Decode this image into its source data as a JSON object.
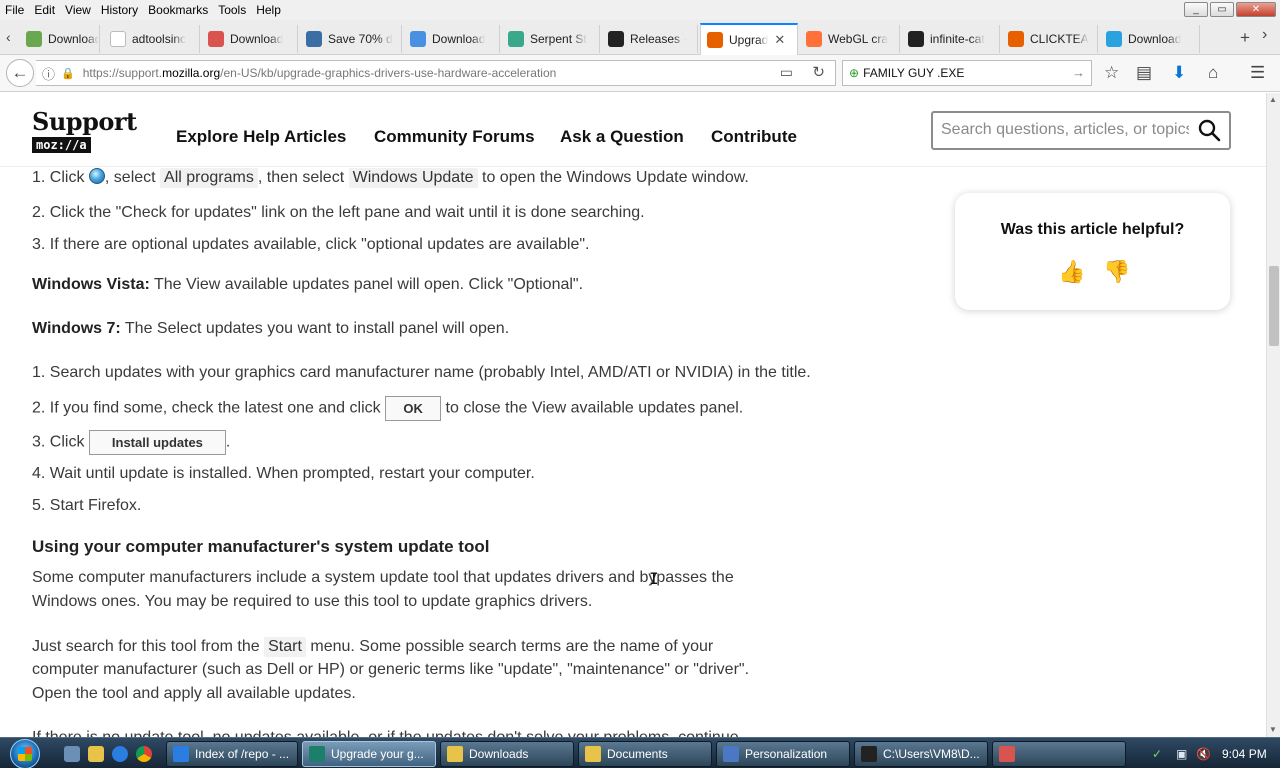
{
  "menubar": {
    "items": [
      {
        "label": "File",
        "key": "F"
      },
      {
        "label": "Edit",
        "key": "E"
      },
      {
        "label": "View",
        "key": "V"
      },
      {
        "label": "History",
        "key": "s"
      },
      {
        "label": "Bookmarks",
        "key": "B"
      },
      {
        "label": "Tools",
        "key": "T"
      },
      {
        "label": "Help",
        "key": "H"
      }
    ],
    "window_controls": [
      "_",
      "▭",
      "✕"
    ]
  },
  "tabs": [
    {
      "label": "Download",
      "color": "#6aa84f"
    },
    {
      "label": "adtoolsinc",
      "color": "#ffffff"
    },
    {
      "label": "Download",
      "color": "#d9534f"
    },
    {
      "label": "Save 70% d",
      "color": "#3b6ea5"
    },
    {
      "label": "Download",
      "color": "#4a90e2"
    },
    {
      "label": "Serpent St",
      "color": "#3aa98b"
    },
    {
      "label": "Releases ·",
      "color": "#222222"
    },
    {
      "label": "Upgrad",
      "color": "#e66000",
      "active": true
    },
    {
      "label": "WebGL cra",
      "color": "#ff7139"
    },
    {
      "label": "infinite-cat",
      "color": "#222222"
    },
    {
      "label": "CLICKTEA",
      "color": "#e66000"
    },
    {
      "label": "Download",
      "color": "#29a3e0"
    }
  ],
  "navbar": {
    "url_prefix": "https://support.",
    "url_domain": "mozilla.org",
    "url_path": "/en-US/kb/upgrade-graphics-drivers-use-hardware-acceleration",
    "search_value": "FAMILY GUY .EXE"
  },
  "site": {
    "logo_word": "Support",
    "logo_badge": "moz://a",
    "nav": [
      "Explore Help Articles",
      "Community Forums",
      "Ask a Question",
      "Contribute"
    ],
    "search_placeholder": "Search questions, articles, or topics"
  },
  "article": {
    "step1_num": "1. Click",
    "step1_mid": ", select",
    "step1_kbd1": "All programs",
    "step1_mid2": ", then select",
    "step1_kbd2": "Windows Update",
    "step1_end": "to open the Windows Update window.",
    "step2": "2. Click the \"Check for updates\" link on the left pane and wait until it is done searching.",
    "step3": "3. If there are optional updates available, click \"optional updates are available\".",
    "vista_label": "Windows Vista:",
    "vista_text": "The View available updates panel will open. Click \"Optional\".",
    "win7_label": "Windows 7:",
    "win7_text": "The Select updates you want to install panel will open.",
    "b1": "1. Search updates with your graphics card manufacturer name (probably Intel, AMD/ATI or NVIDIA) in the title.",
    "b2_start": "2. If you find some, check the latest one and click",
    "b2_btn": "OK",
    "b2_end": "to close the View available updates panel.",
    "b3_start": "3. Click",
    "b3_btn": "Install updates",
    "b3_end": ".",
    "b4": "4. Wait until update is installed. When prompted, restart your computer.",
    "b5": "5. Start Firefox.",
    "heading": "Using your computer manufacturer's system update tool",
    "p1_l1": "Some computer manufacturers include a system update tool that updates drivers and bypasses the",
    "p1_l2": "Windows ones. You may be required to use this tool to update graphics drivers.",
    "p2_l1_start": "Just search for this tool from the",
    "p2_kbd": "Start",
    "p2_l1_end": "menu. Some possible search terms are the name of your",
    "p2_l2": "computer manufacturer (such as Dell or HP) or generic terms like \"update\", \"maintenance\" or \"driver\".",
    "p2_l3": "Open the tool and apply all available updates.",
    "p3_partial": "If there is no update tool, no updates available, or if the updates don't solve your problems, continue"
  },
  "helpful": {
    "question": "Was this article helpful?",
    "yes_icon": "👍",
    "no_icon": "👎"
  },
  "taskbar": {
    "tasks": [
      {
        "label": "Index of /repo - ...",
        "icon": "#2a7de1"
      },
      {
        "label": "Upgrade your g...",
        "icon": "#1b7f6b",
        "active": true
      },
      {
        "label": "Downloads",
        "icon": "#e8c34a"
      },
      {
        "label": "Documents",
        "icon": "#e8c34a"
      },
      {
        "label": "Personalization",
        "icon": "#4a78c2"
      },
      {
        "label": "C:\\Users\\VM8\\D...",
        "icon": "#222222"
      },
      {
        "label": "",
        "icon": "#d9534f"
      }
    ],
    "clock": "9:04 PM"
  }
}
